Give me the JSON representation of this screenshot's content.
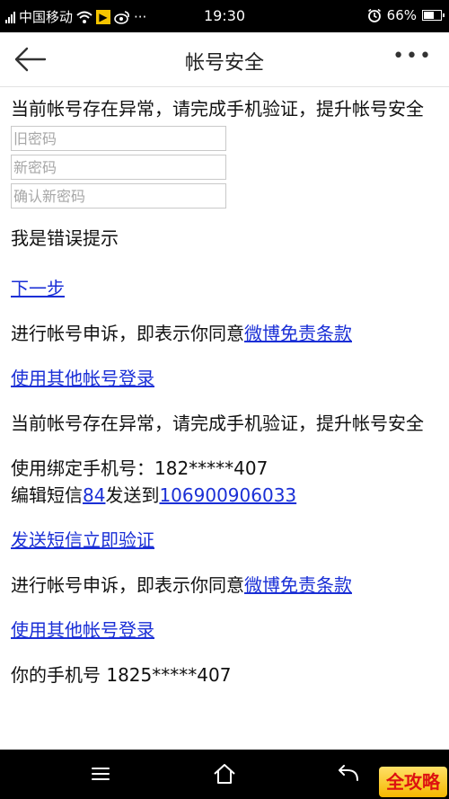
{
  "status_bar": {
    "carrier": "中国移动",
    "time": "19:30",
    "battery": "66%",
    "battery_level": 0.66,
    "icons": [
      "signal-icon",
      "wifi-icon",
      "notification-flag-icon",
      "weibo-icon",
      "more-dots-icon",
      "alarm-icon",
      "battery-icon"
    ],
    "more_dots": "···"
  },
  "header": {
    "title": "帐号安全",
    "back_icon": "back-arrow-icon",
    "more_icon": "more-horizontal-icon",
    "more_label": "•••"
  },
  "section1": {
    "message": "当前帐号存在异常，请完成手机验证，提升帐号安全",
    "old_password_placeholder": "旧密码",
    "new_password_placeholder": "新密码",
    "confirm_password_placeholder": "确认新密码",
    "error_hint": "我是错误提示",
    "next_link": "下一步",
    "appeal_text": "进行帐号申诉，即表示你同意",
    "disclaimer_link": "微博免责条款",
    "other_login_link": "使用其他帐号登录"
  },
  "section2": {
    "message": "当前帐号存在异常，请完成手机验证，提升帐号安全",
    "bound_phone_label": "使用绑定手机号：",
    "bound_phone": "182*****407",
    "sms_prefix": "编辑短信",
    "sms_code": "84",
    "sms_middle": "发送到",
    "sms_number": "106900906033",
    "send_sms_link": "发送短信立即验证",
    "appeal_text": "进行帐号申诉，即表示你同意",
    "disclaimer_link": "微博免责条款",
    "other_login_link": "使用其他帐号登录"
  },
  "section3": {
    "partial_text": "你的手机号 1825*****407"
  },
  "nav_bar": {
    "icons": [
      "menu-icon",
      "home-icon",
      "back-icon"
    ]
  },
  "watermark": {
    "text": "全攻略"
  },
  "colors": {
    "link": "#1a2fd6",
    "status_bar": "#000000",
    "nav_bar": "#000000",
    "background": "#ffffff"
  }
}
